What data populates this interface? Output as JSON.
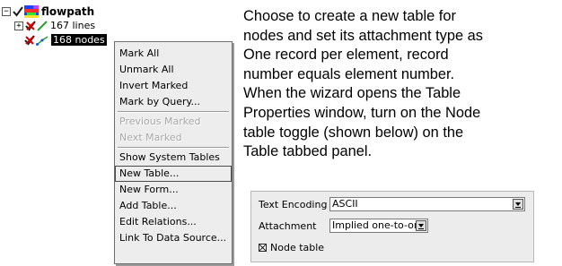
{
  "tree": {
    "root_label": "flowpath",
    "expander_glyph": "⊟",
    "child_expander_glyph": "⊞",
    "items": [
      {
        "label": "167 lines"
      },
      {
        "label": "168 nodes"
      }
    ],
    "colors": {
      "check": "#1b1b1b",
      "cross": "#d60000",
      "selection": "#000000"
    },
    "icons": [
      "checkmark-icon",
      "rainbow-layer-icon",
      "red-x-icon",
      "line-feature-icon",
      "node-feature-icon"
    ]
  },
  "context_menu": {
    "items": [
      {
        "label": "Mark All",
        "disabled": false
      },
      {
        "label": "Unmark All",
        "disabled": false
      },
      {
        "label": "Invert Marked",
        "disabled": false
      },
      {
        "label": "Mark by Query...",
        "disabled": false
      },
      {
        "label": "Previous Marked",
        "disabled": true
      },
      {
        "label": "Next Marked",
        "disabled": true
      },
      {
        "label": "Show System Tables",
        "disabled": false
      },
      {
        "label": "New Table...",
        "disabled": false,
        "highlighted": true
      },
      {
        "label": "New Form...",
        "disabled": false
      },
      {
        "label": "Add Table...",
        "disabled": false
      },
      {
        "label": "Edit Relations...",
        "disabled": false
      },
      {
        "label": "Link To Data Source...",
        "disabled": false
      }
    ]
  },
  "instructions": {
    "lines": [
      "Choose to create a new table for",
      "nodes and set its attachment type as",
      "One record per element, record",
      "number equals element number.",
      "When the wizard opens the Table",
      "Properties window, turn on the Node",
      "table toggle (shown below) on the",
      "Table tabbed panel."
    ]
  },
  "properties_panel": {
    "text_encoding_label": "Text Encoding",
    "text_encoding_value": "ASCII",
    "attachment_label": "Attachment",
    "attachment_value": "Implied one-to-one",
    "node_table_label": "Node table",
    "node_table_checked": true
  }
}
